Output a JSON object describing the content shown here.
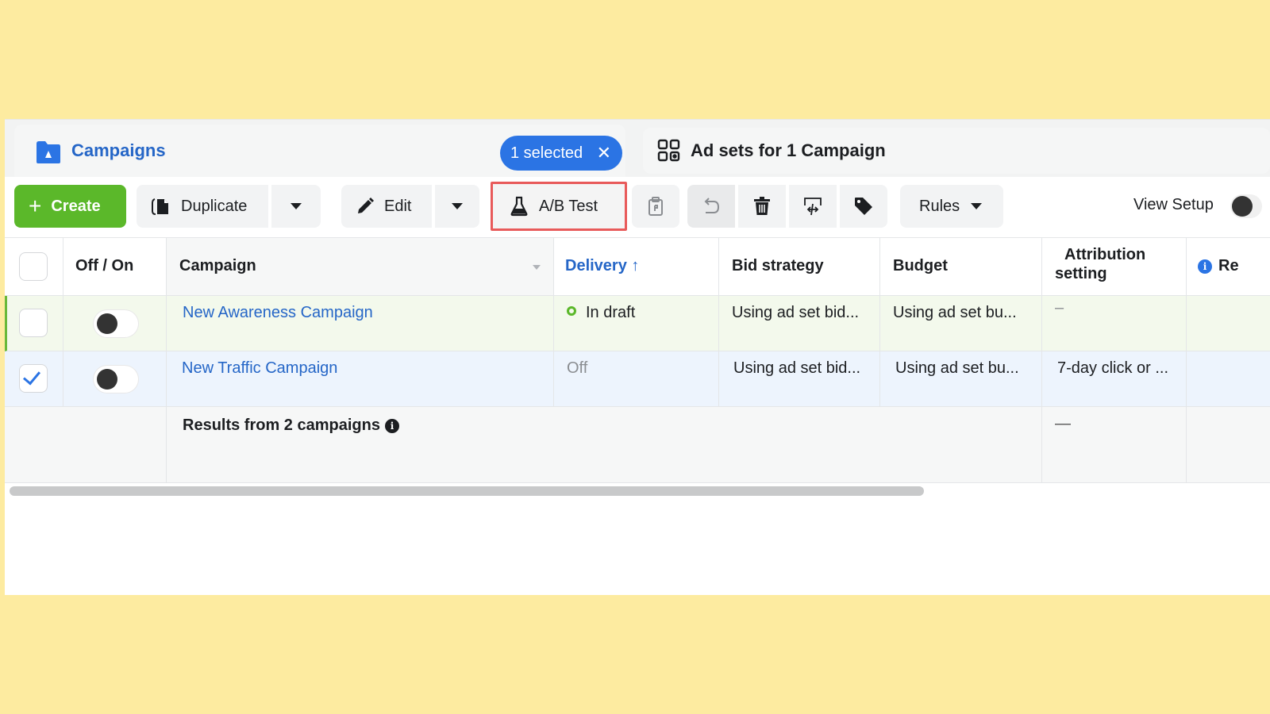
{
  "tabs": {
    "campaigns": {
      "label": "Campaigns",
      "icon": "folder-icon"
    },
    "selection": {
      "label": "1 selected",
      "clear_icon": "close-icon"
    },
    "adsets": {
      "label": "Ad sets for 1 Campaign",
      "icon": "grid-icon"
    }
  },
  "toolbar": {
    "create_label": "Create",
    "create_glyph": "+",
    "duplicate_label": "Duplicate",
    "edit_label": "Edit",
    "ab_test_label": "A/B Test",
    "rules_label": "Rules",
    "view_setup_label": "View Setup",
    "highlight_color": "#e85a5a",
    "create_color": "#5bb82a"
  },
  "table": {
    "columns": {
      "toggle": "Off / On",
      "campaign": "Campaign",
      "delivery": "Delivery ↑",
      "bid_strategy": "Bid strategy",
      "budget": "Budget",
      "attribution_line1": "Attribution",
      "attribution_line2": "setting",
      "results_partial": "Re"
    },
    "rows": [
      {
        "selected": false,
        "on": false,
        "campaign": "New Awareness Campaign",
        "delivery": "In draft",
        "bid_strategy": "Using ad set bid...",
        "budget": "Using ad set bu...",
        "attribution": "–"
      },
      {
        "selected": true,
        "on": false,
        "campaign": "New Traffic Campaign",
        "delivery": "Off",
        "bid_strategy": "Using ad set bid...",
        "budget": "Using ad set bu...",
        "attribution": "7-day click or ..."
      }
    ],
    "summary": {
      "label": "Results from 2 campaigns",
      "attribution": "—"
    }
  },
  "colors": {
    "accent_blue": "#2566c7",
    "pill_blue": "#2b74e4",
    "draft_row_bg": "#f3f9ec",
    "selected_row_bg": "#edf4fd",
    "background": "#fdeba0"
  }
}
